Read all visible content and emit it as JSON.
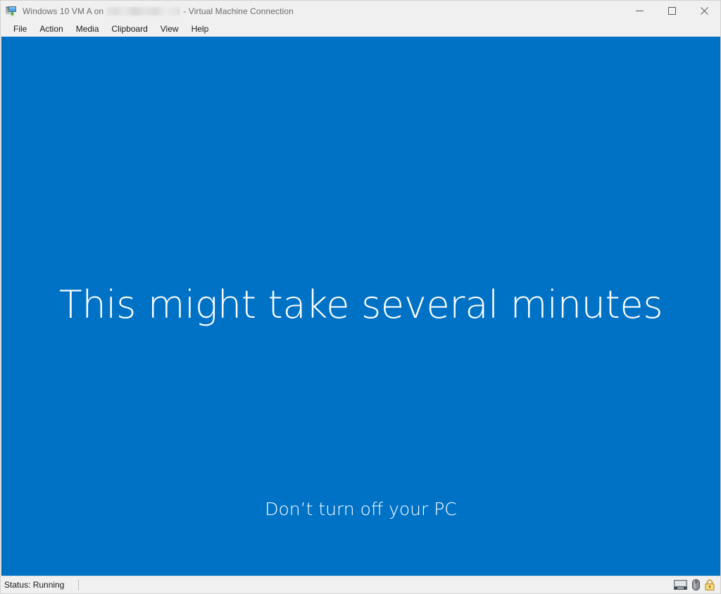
{
  "window": {
    "title_prefix": "Windows 10 VM A on",
    "title_redacted": "",
    "title_suffix": "- Virtual Machine Connection",
    "icon": "virtual-machine-icon",
    "controls": {
      "minimize": "Minimize",
      "maximize": "Maximize",
      "close": "Close"
    }
  },
  "menubar": {
    "items": [
      {
        "label": "File"
      },
      {
        "label": "Action"
      },
      {
        "label": "Media"
      },
      {
        "label": "Clipboard"
      },
      {
        "label": "View"
      },
      {
        "label": "Help"
      }
    ]
  },
  "viewport": {
    "background_color": "#0072c6",
    "heading": "This might take several minutes",
    "subtext": "Don’t turn off your PC"
  },
  "statusbar": {
    "status": "Status: Running",
    "icons": [
      {
        "name": "keyboard-icon"
      },
      {
        "name": "mouse-icon"
      },
      {
        "name": "lock-icon",
        "color": "#e8b73a"
      }
    ]
  }
}
